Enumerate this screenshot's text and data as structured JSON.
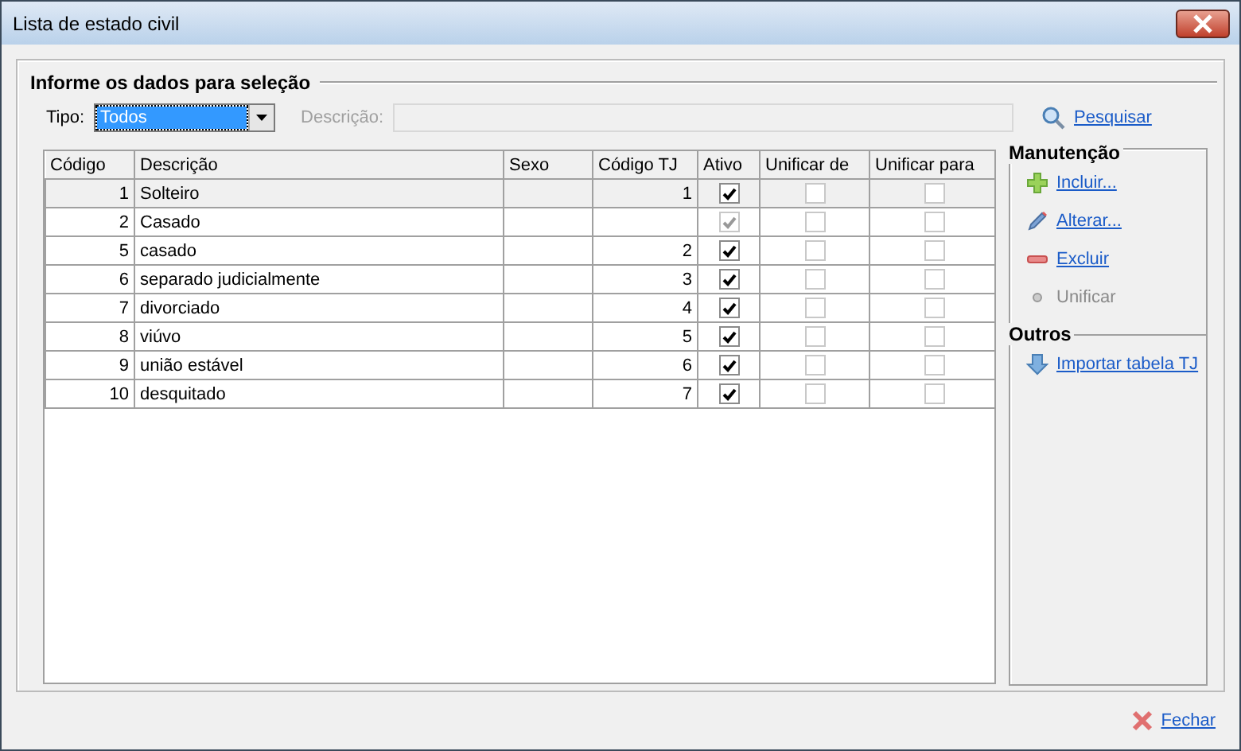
{
  "window": {
    "title": "Lista de estado civil"
  },
  "group": {
    "title": "Informe os dados para seleção"
  },
  "filter": {
    "tipo_label": "Tipo:",
    "tipo_value": "Todos",
    "descricao_label": "Descrição:",
    "descricao_disabled": true,
    "search": "Pesquisar"
  },
  "table": {
    "columns": [
      "Código",
      "Descrição",
      "Sexo",
      "Código TJ",
      "Ativo",
      "Unificar de",
      "Unificar para"
    ],
    "rows": [
      {
        "codigo": "1",
        "descricao": "Solteiro",
        "codigo_tj": "1",
        "ativo": true,
        "ativo_disabled": false,
        "selected": true
      },
      {
        "codigo": "2",
        "descricao": "Casado",
        "ativo": true,
        "ativo_disabled": true,
        "selected": false
      },
      {
        "codigo": "5",
        "descricao": "casado",
        "codigo_tj": "2",
        "ativo": true,
        "ativo_disabled": false,
        "selected": false
      },
      {
        "codigo": "6",
        "descricao": "separado judicialmente",
        "codigo_tj": "3",
        "ativo": true,
        "ativo_disabled": false,
        "selected": false
      },
      {
        "codigo": "7",
        "descricao": "divorciado",
        "codigo_tj": "4",
        "ativo": true,
        "ativo_disabled": false,
        "selected": false
      },
      {
        "codigo": "8",
        "descricao": "viúvo",
        "codigo_tj": "5",
        "ativo": true,
        "ativo_disabled": false,
        "selected": false
      },
      {
        "codigo": "9",
        "descricao": "união estável",
        "codigo_tj": "6",
        "ativo": true,
        "ativo_disabled": false,
        "selected": false
      },
      {
        "codigo": "10",
        "descricao": "desquitado",
        "codigo_tj": "7",
        "ativo": true,
        "ativo_disabled": false,
        "selected": false
      }
    ]
  },
  "sections": [
    {
      "title": "Manutenção",
      "actions": [
        {
          "kind": "add",
          "label": "Incluir...",
          "disabled": false
        },
        {
          "kind": "edit",
          "label": "Alterar...",
          "disabled": false
        },
        {
          "kind": "delete",
          "label": "Excluir",
          "disabled": false
        },
        {
          "kind": "merge",
          "label": "Unificar",
          "disabled": true
        }
      ]
    },
    {
      "title": "Outros",
      "actions": [
        {
          "kind": "import",
          "label": "Importar tabela TJ",
          "disabled": false
        }
      ]
    }
  ],
  "close": "Fechar"
}
